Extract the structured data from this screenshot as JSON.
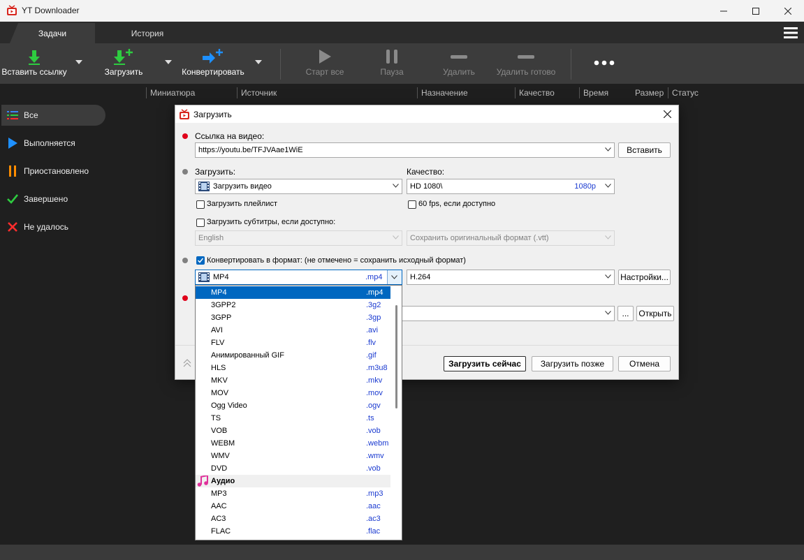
{
  "window": {
    "title": "YT Downloader",
    "minimize_icon": "minimize-icon",
    "maximize_icon": "maximize-icon",
    "close_icon": "close-icon"
  },
  "tabs": [
    {
      "label": "Задачи",
      "active": true
    },
    {
      "label": "История",
      "active": false
    }
  ],
  "toolbar": {
    "paste_link": "Вставить ссылку",
    "download": "Загрузить",
    "convert": "Конвертировать",
    "start_all": "Старт все",
    "pause": "Пауза",
    "delete": "Удалить",
    "delete_done": "Удалить готово",
    "more_icon": "more-icon"
  },
  "columns": [
    "Миниатюра",
    "Источник",
    "Назначение",
    "Качество",
    "Время",
    "Размер",
    "Статус"
  ],
  "sidebar": {
    "items": [
      {
        "label": "Все",
        "icon": "list-icon",
        "color": "#3b82f6"
      },
      {
        "label": "Выполняется",
        "icon": "play-icon",
        "color": "#1e90ff"
      },
      {
        "label": "Приостановлено",
        "icon": "pause-icon",
        "color": "#ff8c00"
      },
      {
        "label": "Завершено",
        "icon": "check-icon",
        "color": "#2ecc40"
      },
      {
        "label": "Не удалось",
        "icon": "x-icon",
        "color": "#ff2d2d"
      }
    ]
  },
  "dialog": {
    "title": "Загрузить",
    "url_label": "Ссылка на видео:",
    "url_value": "https://youtu.be/TFJVAae1WiE",
    "paste_button": "Вставить",
    "download_label": "Загрузить:",
    "download_value": "Загрузить видео",
    "quality_label": "Качество:",
    "quality_value": "HD 1080\\",
    "quality_tag": "1080p",
    "playlist_checkbox": "Загрузить плейлист",
    "fps_checkbox": "60 fps, если доступно",
    "subtitles_checkbox": "Загрузить субтитры, если доступно:",
    "subtitle_language": "English",
    "subtitle_format": "Сохранить оригинальный формат (.vtt)",
    "convert_checkbox": "Конвертировать в формат: (не отмечено = сохранить исходный формат)",
    "format_value": "MP4",
    "format_ext": ".mp4",
    "codec_value": "H.264",
    "settings_button": "Настройки...",
    "browse_button": "...",
    "open_button": "Открыть",
    "download_now": "Загрузить сейчас",
    "download_later": "Загрузить позже",
    "cancel": "Отмена",
    "accent": "#0067c0",
    "required_dot_color": "#e0001a"
  },
  "format_options": [
    {
      "name": "MP4",
      "ext": ".mp4",
      "selected": true
    },
    {
      "name": "3GPP2",
      "ext": ".3g2"
    },
    {
      "name": "3GPP",
      "ext": ".3gp"
    },
    {
      "name": "AVI",
      "ext": ".avi"
    },
    {
      "name": "FLV",
      "ext": ".flv"
    },
    {
      "name": "Анимированный GIF",
      "ext": ".gif"
    },
    {
      "name": "HLS",
      "ext": ".m3u8"
    },
    {
      "name": "MKV",
      "ext": ".mkv"
    },
    {
      "name": "MOV",
      "ext": ".mov"
    },
    {
      "name": "Ogg Video",
      "ext": ".ogv"
    },
    {
      "name": "TS",
      "ext": ".ts"
    },
    {
      "name": "VOB",
      "ext": ".vob"
    },
    {
      "name": "WEBM",
      "ext": ".webm"
    },
    {
      "name": "WMV",
      "ext": ".wmv"
    },
    {
      "name": "DVD",
      "ext": ".vob"
    },
    {
      "name": "Аудио",
      "category": true,
      "icon": "music-note-icon"
    },
    {
      "name": "MP3",
      "ext": ".mp3"
    },
    {
      "name": "AAC",
      "ext": ".aac"
    },
    {
      "name": "AC3",
      "ext": ".ac3"
    },
    {
      "name": "FLAC",
      "ext": ".flac"
    }
  ]
}
